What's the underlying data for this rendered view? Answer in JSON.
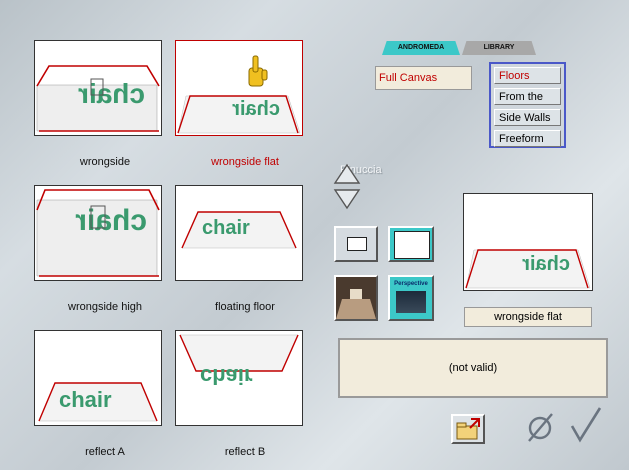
{
  "tabs": [
    {
      "label": "ANDROMEDA",
      "color": "#3cc8c8"
    },
    {
      "label": "LIBRARY",
      "color": "#a8a8a8"
    }
  ],
  "mode_label": "Full Canvas",
  "list_items": [
    "Floors",
    "From the Top",
    "Side Walls",
    "Freeform"
  ],
  "selected_list_item": "Floors",
  "presets": [
    "wrongside",
    "wrongside flat",
    "wrongside high",
    "floating floor",
    "reflect A",
    "reflect B"
  ],
  "selected_preset": "wrongside flat",
  "thumb_word": "chair",
  "preview_label": "wrongside flat",
  "status": "(not valid)",
  "perspective_label": "Perspective",
  "watermark": "Pinuccia",
  "colors": {
    "accent_red": "#c00000",
    "floor_green": "#3a9a6e",
    "list_border": "#4a58c8",
    "cyan": "#3cc8c8"
  }
}
